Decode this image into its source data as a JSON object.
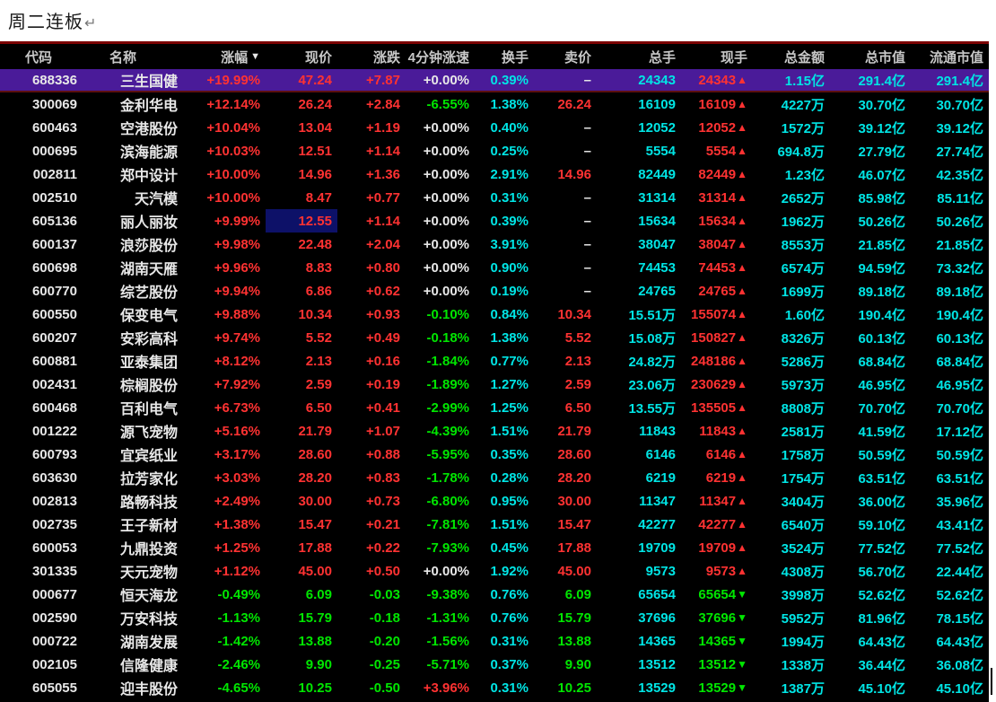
{
  "page": {
    "title": "周二连板",
    "return_mark": "↵"
  },
  "colors": {
    "up_red": "#ff3232",
    "down_green": "#00e600",
    "cyan": "#00e5e5",
    "neutral_white": "#e8e8e8",
    "header_text": "#c8c8c8",
    "selected_row_bg": "#4a1b99",
    "highlight_cell_bg": "#0d1168",
    "table_bg": "#000000",
    "table_top_border": "#7a0000"
  },
  "table": {
    "columns": [
      {
        "key": "code",
        "label": "代码",
        "align": "left"
      },
      {
        "key": "name",
        "label": "名称",
        "align": "left"
      },
      {
        "key": "pct",
        "label": "涨幅",
        "align": "right",
        "sort_icon": "▼"
      },
      {
        "key": "price",
        "label": "现价",
        "align": "right"
      },
      {
        "key": "chg",
        "label": "涨跌",
        "align": "right"
      },
      {
        "key": "speed",
        "label": "4分钟涨速",
        "align": "right"
      },
      {
        "key": "turnover",
        "label": "换手",
        "align": "right"
      },
      {
        "key": "ask",
        "label": "卖价",
        "align": "right"
      },
      {
        "key": "volume",
        "label": "总手",
        "align": "right"
      },
      {
        "key": "current",
        "label": "现手",
        "align": "right"
      },
      {
        "key": "amount",
        "label": "总金额",
        "align": "right"
      },
      {
        "key": "mktcap",
        "label": "总市值",
        "align": "right"
      },
      {
        "key": "floatcap",
        "label": "流通市值",
        "align": "right"
      }
    ],
    "rows": [
      {
        "code": "688336",
        "name": "三生国健",
        "pct": "+19.99%",
        "price": "47.24",
        "chg": "+7.87",
        "speed": "+0.00%",
        "turnover": "0.39%",
        "ask": "–",
        "volume": "24343",
        "current": "24343",
        "trend": "up",
        "amount": "1.15亿",
        "mktcap": "291.4亿",
        "floatcap": "291.4亿",
        "selected": true
      },
      {
        "code": "300069",
        "name": "金利华电",
        "pct": "+12.14%",
        "price": "26.24",
        "chg": "+2.84",
        "speed": "-6.55%",
        "turnover": "1.38%",
        "ask": "26.24",
        "volume": "16109",
        "current": "16109",
        "trend": "up",
        "amount": "4227万",
        "mktcap": "30.70亿",
        "floatcap": "30.70亿"
      },
      {
        "code": "600463",
        "name": "空港股份",
        "pct": "+10.04%",
        "price": "13.04",
        "chg": "+1.19",
        "speed": "+0.00%",
        "turnover": "0.40%",
        "ask": "–",
        "volume": "12052",
        "current": "12052",
        "trend": "up",
        "amount": "1572万",
        "mktcap": "39.12亿",
        "floatcap": "39.12亿"
      },
      {
        "code": "000695",
        "name": "滨海能源",
        "pct": "+10.03%",
        "price": "12.51",
        "chg": "+1.14",
        "speed": "+0.00%",
        "turnover": "0.25%",
        "ask": "–",
        "volume": "5554",
        "current": "5554",
        "trend": "up",
        "amount": "694.8万",
        "mktcap": "27.79亿",
        "floatcap": "27.74亿"
      },
      {
        "code": "002811",
        "name": "郑中设计",
        "pct": "+10.00%",
        "price": "14.96",
        "chg": "+1.36",
        "speed": "+0.00%",
        "turnover": "2.91%",
        "ask": "14.96",
        "volume": "82449",
        "current": "82449",
        "trend": "up",
        "amount": "1.23亿",
        "mktcap": "46.07亿",
        "floatcap": "42.35亿"
      },
      {
        "code": "002510",
        "name": "天汽模",
        "pct": "+10.00%",
        "price": "8.47",
        "chg": "+0.77",
        "speed": "+0.00%",
        "turnover": "0.31%",
        "ask": "–",
        "volume": "31314",
        "current": "31314",
        "trend": "up",
        "amount": "2652万",
        "mktcap": "85.98亿",
        "floatcap": "85.11亿"
      },
      {
        "code": "605136",
        "name": "丽人丽妆",
        "pct": "+9.99%",
        "price": "12.55",
        "chg": "+1.14",
        "speed": "+0.00%",
        "turnover": "0.39%",
        "ask": "–",
        "volume": "15634",
        "current": "15634",
        "trend": "up",
        "amount": "1962万",
        "mktcap": "50.26亿",
        "floatcap": "50.26亿",
        "price_highlight": true
      },
      {
        "code": "600137",
        "name": "浪莎股份",
        "pct": "+9.98%",
        "price": "22.48",
        "chg": "+2.04",
        "speed": "+0.00%",
        "turnover": "3.91%",
        "ask": "–",
        "volume": "38047",
        "current": "38047",
        "trend": "up",
        "amount": "8553万",
        "mktcap": "21.85亿",
        "floatcap": "21.85亿"
      },
      {
        "code": "600698",
        "name": "湖南天雁",
        "pct": "+9.96%",
        "price": "8.83",
        "chg": "+0.80",
        "speed": "+0.00%",
        "turnover": "0.90%",
        "ask": "–",
        "volume": "74453",
        "current": "74453",
        "trend": "up",
        "amount": "6574万",
        "mktcap": "94.59亿",
        "floatcap": "73.32亿"
      },
      {
        "code": "600770",
        "name": "综艺股份",
        "pct": "+9.94%",
        "price": "6.86",
        "chg": "+0.62",
        "speed": "+0.00%",
        "turnover": "0.19%",
        "ask": "–",
        "volume": "24765",
        "current": "24765",
        "trend": "up",
        "amount": "1699万",
        "mktcap": "89.18亿",
        "floatcap": "89.18亿"
      },
      {
        "code": "600550",
        "name": "保变电气",
        "pct": "+9.88%",
        "price": "10.34",
        "chg": "+0.93",
        "speed": "-0.10%",
        "turnover": "0.84%",
        "ask": "10.34",
        "volume": "15.51万",
        "current": "155074",
        "trend": "up",
        "amount": "1.60亿",
        "mktcap": "190.4亿",
        "floatcap": "190.4亿"
      },
      {
        "code": "600207",
        "name": "安彩高科",
        "pct": "+9.74%",
        "price": "5.52",
        "chg": "+0.49",
        "speed": "-0.18%",
        "turnover": "1.38%",
        "ask": "5.52",
        "volume": "15.08万",
        "current": "150827",
        "trend": "up",
        "amount": "8326万",
        "mktcap": "60.13亿",
        "floatcap": "60.13亿"
      },
      {
        "code": "600881",
        "name": "亚泰集团",
        "pct": "+8.12%",
        "price": "2.13",
        "chg": "+0.16",
        "speed": "-1.84%",
        "turnover": "0.77%",
        "ask": "2.13",
        "volume": "24.82万",
        "current": "248186",
        "trend": "up",
        "amount": "5286万",
        "mktcap": "68.84亿",
        "floatcap": "68.84亿"
      },
      {
        "code": "002431",
        "name": "棕榈股份",
        "pct": "+7.92%",
        "price": "2.59",
        "chg": "+0.19",
        "speed": "-1.89%",
        "turnover": "1.27%",
        "ask": "2.59",
        "volume": "23.06万",
        "current": "230629",
        "trend": "up",
        "amount": "5973万",
        "mktcap": "46.95亿",
        "floatcap": "46.95亿"
      },
      {
        "code": "600468",
        "name": "百利电气",
        "pct": "+6.73%",
        "price": "6.50",
        "chg": "+0.41",
        "speed": "-2.99%",
        "turnover": "1.25%",
        "ask": "6.50",
        "volume": "13.55万",
        "current": "135505",
        "trend": "up",
        "amount": "8808万",
        "mktcap": "70.70亿",
        "floatcap": "70.70亿"
      },
      {
        "code": "001222",
        "name": "源飞宠物",
        "pct": "+5.16%",
        "price": "21.79",
        "chg": "+1.07",
        "speed": "-4.39%",
        "turnover": "1.51%",
        "ask": "21.79",
        "volume": "11843",
        "current": "11843",
        "trend": "up",
        "amount": "2581万",
        "mktcap": "41.59亿",
        "floatcap": "17.12亿"
      },
      {
        "code": "600793",
        "name": "宜宾纸业",
        "pct": "+3.17%",
        "price": "28.60",
        "chg": "+0.88",
        "speed": "-5.95%",
        "turnover": "0.35%",
        "ask": "28.60",
        "volume": "6146",
        "current": "6146",
        "trend": "up",
        "amount": "1758万",
        "mktcap": "50.59亿",
        "floatcap": "50.59亿"
      },
      {
        "code": "603630",
        "name": "拉芳家化",
        "pct": "+3.03%",
        "price": "28.20",
        "chg": "+0.83",
        "speed": "-1.78%",
        "turnover": "0.28%",
        "ask": "28.20",
        "volume": "6219",
        "current": "6219",
        "trend": "up",
        "amount": "1754万",
        "mktcap": "63.51亿",
        "floatcap": "63.51亿"
      },
      {
        "code": "002813",
        "name": "路畅科技",
        "pct": "+2.49%",
        "price": "30.00",
        "chg": "+0.73",
        "speed": "-6.80%",
        "turnover": "0.95%",
        "ask": "30.00",
        "volume": "11347",
        "current": "11347",
        "trend": "up",
        "amount": "3404万",
        "mktcap": "36.00亿",
        "floatcap": "35.96亿"
      },
      {
        "code": "002735",
        "name": "王子新材",
        "pct": "+1.38%",
        "price": "15.47",
        "chg": "+0.21",
        "speed": "-7.81%",
        "turnover": "1.51%",
        "ask": "15.47",
        "volume": "42277",
        "current": "42277",
        "trend": "up",
        "amount": "6540万",
        "mktcap": "59.10亿",
        "floatcap": "43.41亿"
      },
      {
        "code": "600053",
        "name": "九鼎投资",
        "pct": "+1.25%",
        "price": "17.88",
        "chg": "+0.22",
        "speed": "-7.93%",
        "turnover": "0.45%",
        "ask": "17.88",
        "volume": "19709",
        "current": "19709",
        "trend": "up",
        "amount": "3524万",
        "mktcap": "77.52亿",
        "floatcap": "77.52亿"
      },
      {
        "code": "301335",
        "name": "天元宠物",
        "pct": "+1.12%",
        "price": "45.00",
        "chg": "+0.50",
        "speed": "+0.00%",
        "turnover": "1.92%",
        "ask": "45.00",
        "volume": "9573",
        "current": "9573",
        "trend": "up",
        "amount": "4308万",
        "mktcap": "56.70亿",
        "floatcap": "22.44亿"
      },
      {
        "code": "000677",
        "name": "恒天海龙",
        "pct": "-0.49%",
        "price": "6.09",
        "chg": "-0.03",
        "speed": "-9.38%",
        "turnover": "0.76%",
        "ask": "6.09",
        "volume": "65654",
        "current": "65654",
        "trend": "down",
        "amount": "3998万",
        "mktcap": "52.62亿",
        "floatcap": "52.62亿"
      },
      {
        "code": "002590",
        "name": "万安科技",
        "pct": "-1.13%",
        "price": "15.79",
        "chg": "-0.18",
        "speed": "-1.31%",
        "turnover": "0.76%",
        "ask": "15.79",
        "volume": "37696",
        "current": "37696",
        "trend": "down",
        "amount": "5952万",
        "mktcap": "81.96亿",
        "floatcap": "78.15亿"
      },
      {
        "code": "000722",
        "name": "湖南发展",
        "pct": "-1.42%",
        "price": "13.88",
        "chg": "-0.20",
        "speed": "-1.56%",
        "turnover": "0.31%",
        "ask": "13.88",
        "volume": "14365",
        "current": "14365",
        "trend": "down",
        "amount": "1994万",
        "mktcap": "64.43亿",
        "floatcap": "64.43亿"
      },
      {
        "code": "002105",
        "name": "信隆健康",
        "pct": "-2.46%",
        "price": "9.90",
        "chg": "-0.25",
        "speed": "-5.71%",
        "turnover": "0.37%",
        "ask": "9.90",
        "volume": "13512",
        "current": "13512",
        "trend": "down",
        "amount": "1338万",
        "mktcap": "36.44亿",
        "floatcap": "36.08亿"
      },
      {
        "code": "605055",
        "name": "迎丰股份",
        "pct": "-4.65%",
        "price": "10.25",
        "chg": "-0.50",
        "speed": "+3.96%",
        "turnover": "0.31%",
        "ask": "10.25",
        "volume": "13529",
        "current": "13529",
        "trend": "down",
        "amount": "1387万",
        "mktcap": "45.10亿",
        "floatcap": "45.10亿"
      }
    ]
  }
}
